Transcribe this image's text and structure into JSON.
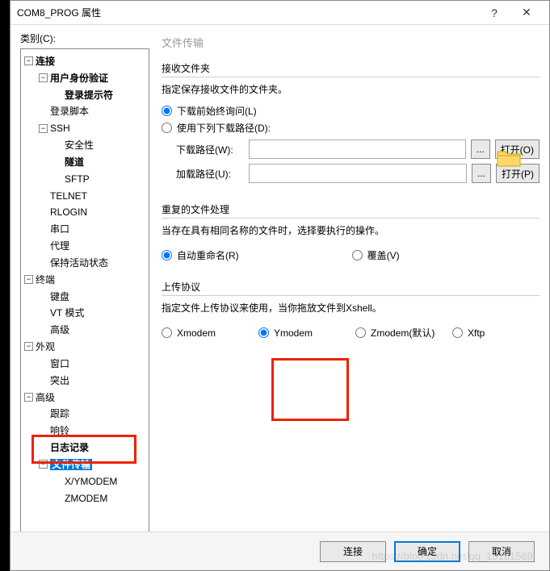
{
  "titlebar": {
    "title": "COM8_PROG 属性"
  },
  "category_label": "类别(C):",
  "tree": {
    "l1": "连接",
    "l1_1": "用户身份验证",
    "l1_1_1": "登录提示符",
    "l1_2": "登录脚本",
    "l1_3": "SSH",
    "l1_3_1": "安全性",
    "l1_3_2": "隧道",
    "l1_3_3": "SFTP",
    "l1_4": "TELNET",
    "l1_5": "RLOGIN",
    "l1_6": "串口",
    "l1_7": "代理",
    "l1_8": "保持活动状态",
    "l2": "终端",
    "l2_1": "键盘",
    "l2_2": "VT 模式",
    "l2_3": "高级",
    "l3": "外观",
    "l3_1": "窗口",
    "l3_2": "突出",
    "l4": "高级",
    "l4_1": "跟踪",
    "l4_2": "响铃",
    "l4_3": "日志记录",
    "l4_4": "文件传输",
    "l4_4_1": "X/YMODEM",
    "l4_4_2": "ZMODEM"
  },
  "right": {
    "panel_title": "文件传输",
    "recv_label": "接收文件夹",
    "recv_desc": "指定保存接收文件的文件夹。",
    "ask_before": "下载前始终询问(L)",
    "use_path": "使用下列下载路径(D):",
    "down_path_label": "下载路径(W):",
    "up_path_label": "加载路径(U):",
    "open_o": "打开(O)",
    "open_p": "打开(P)",
    "dup_label": "重复的文件处理",
    "dup_desc": "当存在具有相同名称的文件时，选择要执行的操作。",
    "auto_rename": "自动重命名(R)",
    "overwrite": "覆盖(V)",
    "upload_label": "上传协议",
    "upload_desc": "指定文件上传协议来使用，当你拖放文件到Xshell。",
    "xmodem": "Xmodem",
    "ymodem": "Ymodem",
    "zmodem": "Zmodem(默认)",
    "xftp": "Xftp",
    "down_path_value": "",
    "up_path_value": ""
  },
  "footer": {
    "connect": "连接",
    "ok": "确定",
    "cancel": "取消"
  },
  "watermark": "https://blog.csdn.net/qq_15181569"
}
